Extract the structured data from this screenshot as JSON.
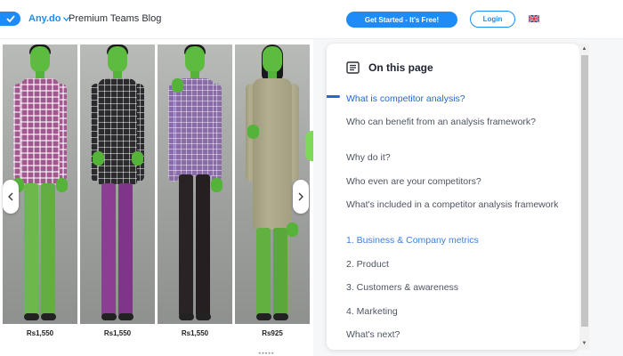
{
  "header": {
    "brand": "Any.do",
    "nav_text": "Premium Teams Blog",
    "cta_label": "Get Started - It's Free!",
    "login_label": "Login",
    "lang_code": "",
    "colors": {
      "accent": "#1d8cf8"
    }
  },
  "carousel": {
    "products": [
      {
        "price": "Rs1,550"
      },
      {
        "price": "Rs1,550"
      },
      {
        "price": "Rs1,550"
      },
      {
        "price": "Rs925"
      }
    ],
    "prev_icon": "chevron-left-icon",
    "next_icon": "chevron-right-icon",
    "rating_text": "★★★★★"
  },
  "toc": {
    "title": "On this page",
    "items": [
      {
        "label": "What is competitor analysis?"
      },
      {
        "label": "Who can benefit from an analysis framework?"
      },
      {
        "label": "Why do it?"
      },
      {
        "label": "Who even are your competitors?"
      },
      {
        "label": "What's included in a competitor analysis framework"
      },
      {
        "label": "1. Business & Company metrics"
      },
      {
        "label": "2. Product"
      },
      {
        "label": "3. Customers & awareness"
      },
      {
        "label": "4. Marketing"
      },
      {
        "label": "What's next?"
      }
    ]
  }
}
